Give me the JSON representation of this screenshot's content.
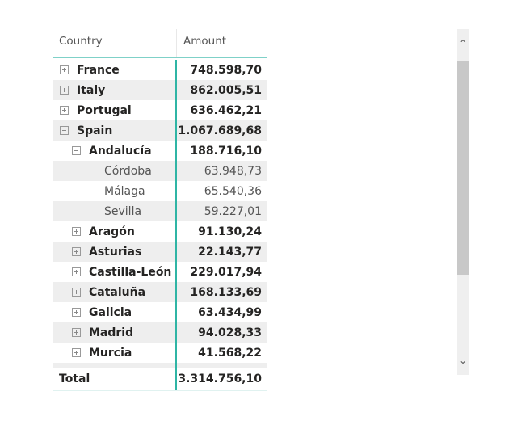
{
  "header": {
    "col1": "Country",
    "col2": "Amount"
  },
  "rows": [
    {
      "label": "France",
      "value": "748.598,70",
      "level": 0,
      "state": "collapsed"
    },
    {
      "label": "Italy",
      "value": "862.005,51",
      "level": 0,
      "state": "collapsed"
    },
    {
      "label": "Portugal",
      "value": "636.462,21",
      "level": 0,
      "state": "collapsed"
    },
    {
      "label": "Spain",
      "value": "1.067.689,68",
      "level": 0,
      "state": "expanded"
    },
    {
      "label": "Andalucía",
      "value": "188.716,10",
      "level": 1,
      "state": "expanded"
    },
    {
      "label": "Córdoba",
      "value": "63.948,73",
      "level": 2,
      "state": "leaf"
    },
    {
      "label": "Málaga",
      "value": "65.540,36",
      "level": 2,
      "state": "leaf"
    },
    {
      "label": "Sevilla",
      "value": "59.227,01",
      "level": 2,
      "state": "leaf"
    },
    {
      "label": "Aragón",
      "value": "91.130,24",
      "level": 1,
      "state": "collapsed"
    },
    {
      "label": "Asturias",
      "value": "22.143,77",
      "level": 1,
      "state": "collapsed"
    },
    {
      "label": "Castilla-León",
      "value": "229.017,94",
      "level": 1,
      "state": "collapsed"
    },
    {
      "label": "Cataluña",
      "value": "168.133,69",
      "level": 1,
      "state": "collapsed"
    },
    {
      "label": "Galicia",
      "value": "63.434,99",
      "level": 1,
      "state": "collapsed"
    },
    {
      "label": "Madrid",
      "value": "94.028,33",
      "level": 1,
      "state": "collapsed"
    },
    {
      "label": "Murcia",
      "value": "41.568,22",
      "level": 1,
      "state": "collapsed"
    }
  ],
  "total": {
    "label": "Total",
    "value": "3.314.756,10"
  },
  "scrollbar": {
    "up_icon": "^",
    "down_icon": "v",
    "position_fraction": 0.0,
    "visible_fraction": 0.62
  },
  "colors": {
    "accent": "#2fb5a5",
    "alt_row": "#eeeeee"
  }
}
